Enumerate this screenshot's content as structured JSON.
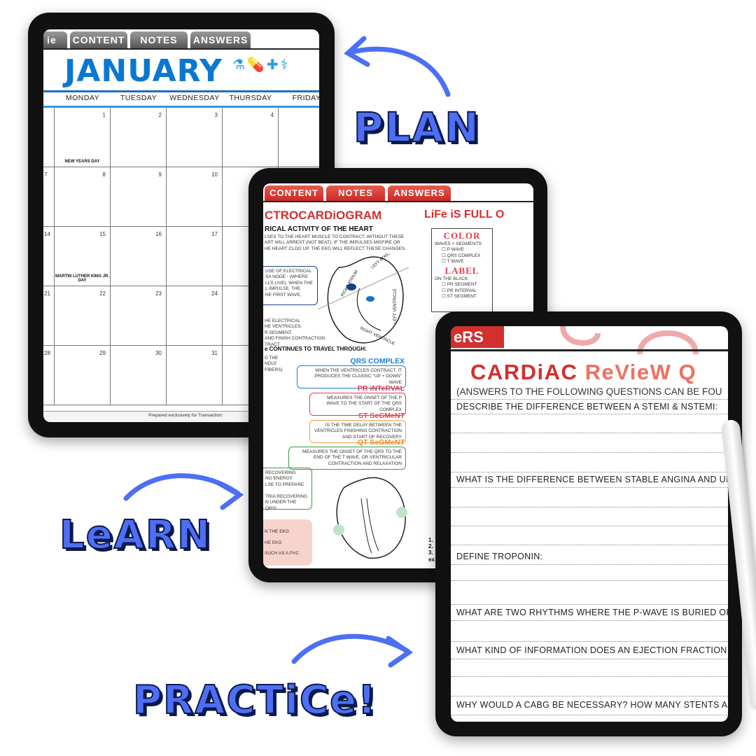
{
  "labels": {
    "plan": "PLAN",
    "learn": "LeARN",
    "practice": "PRACTiCe!"
  },
  "colors": {
    "accent_blue": "#4d6ff5",
    "calendar_blue": "#0a78d0",
    "ekg_red": "#d32f2f",
    "tab_grey": "#777777"
  },
  "calendar": {
    "tabs": [
      "ie",
      "CONTENT",
      "NOTES",
      "ANSWERS"
    ],
    "month": "JANUARY",
    "days": [
      "MONDAY",
      "TUESDAY",
      "WEDNESDAY",
      "THURSDAY",
      "FRIDAY"
    ],
    "weeks": [
      {
        "sun": "",
        "dates": [
          "1",
          "2",
          "3",
          "4",
          ""
        ],
        "holiday": "NEW YEARS DAY"
      },
      {
        "sun": "7",
        "dates": [
          "8",
          "9",
          "10",
          "",
          ""
        ],
        "holiday": ""
      },
      {
        "sun": "14",
        "dates": [
          "15",
          "16",
          "17",
          "",
          ""
        ],
        "holiday": "MARTIN LUTHER KING JR. DAY"
      },
      {
        "sun": "21",
        "dates": [
          "22",
          "23",
          "24",
          "",
          ""
        ],
        "holiday": ""
      },
      {
        "sun": "28",
        "dates": [
          "29",
          "30",
          "31",
          "",
          ""
        ],
        "holiday": ""
      }
    ],
    "footer": "Prepared exclusively for   Transaction: "
  },
  "ekg": {
    "tabs": [
      "CONTENT",
      "NOTES",
      "ANSWERS"
    ],
    "title": "CTROCARDiOGRAM",
    "subtitle": "RICAL ACTIVITY OF THE HEART",
    "intro": [
      "LSES TO THE HEART MUSCLE TO CONTRACT. WITHOUT THESE",
      "ART WILL ARREST (NOT BEAT). IF THE IMPULSES MISFIRE OR",
      "HE HEART CLOG UP, THE EKG WILL REFLECT THESE CHANGES."
    ],
    "sa_box": [
      "USE OF ELECTRICAL",
      "SA NODE - (WHERE",
      "LLS LIVE). WHEN THE",
      "L IMPULSE, THE",
      "HE FIRST WAVE,"
    ],
    "heart_labels": [
      "LEFT ATRIUM",
      "RIGHT ATRIUM",
      "LEFT VENTRICLE",
      "RIGHT VENTRICLE"
    ],
    "pr_text": [
      "HE ELECTRICAL",
      "HE VENTRICLES.",
      "R SEGMENT,",
      "AND FINISH CONTRACTION",
      "TRACT."
    ],
    "travel": "e CONTINUES TO TRAVEL THROUGH:",
    "bundle": [
      "D THE",
      "NDLE",
      "FIBERS)"
    ],
    "sections": [
      {
        "title": "QRS COMPLEX",
        "text": "WHEN THE VENTRICLES CONTRACT, IT PRODUCES THE CLASSIC \"UP + DOWN\" WAVE",
        "color": "#1a7fd0"
      },
      {
        "title": "PR iNTeRVAL",
        "text": "MEASURES THE ONSET OF THE P WAVE TO THE START OF THE QRS COMPLEX",
        "color": "#e33a4a"
      },
      {
        "title": "ST SeGMeNT",
        "text": "IS THE TIME DELAY BETWEEN THE VENTRICLES FINISHING CONTRACTION AND START OF RECOVERY",
        "color": "#ef3b4f"
      },
      {
        "title": "QT SeGMeNT",
        "text": "MEASURES THE ONSET OF THE QRS TO THE END OF THE T WAVE, OR VENTRICULAR CONTRACTION AND RELAXATION",
        "color": "#f08a20"
      }
    ],
    "recover_box": [
      "RECOVERING",
      "NG ENERGY",
      "LSE TO PREPARE",
      "",
      "TRIA RECOVERING",
      "N UNDER THE QRS!"
    ],
    "pink_box": [
      "N THE EKG",
      "HE EKG",
      "SUCH AS A PVC"
    ],
    "right_title": "LiFe iS FULL O",
    "color_head": "COLOR",
    "color_sub": "WAVES + SEGMENTS:",
    "color_items": [
      "P WAVE",
      "QRS COMPLEX",
      "T WAVE"
    ],
    "label_head": "LABEL",
    "label_sub": "ON THE BLACK",
    "label_items": [
      "PR SEGMENT",
      "PR INTERVAL",
      "ST SEGMENT"
    ],
    "list_nums": [
      "1.",
      "2.",
      "3.",
      "ex"
    ]
  },
  "quiz": {
    "tab": "eRS",
    "title_a": "CARDiAC ",
    "title_b": "ReVieW Q",
    "subtitle": "(ANSWERS TO THE FOLLOWING QUESTIONS CAN BE FOU",
    "questions": [
      "DESCRIBE THE DIFFERENCE BETWEEN A STEMI & NSTEMI:",
      "WHAT IS THE DIFFERENCE BETWEEN STABLE ANGINA AND UI",
      "DEFINE TROPONIN:",
      "WHAT ARE TWO RHYTHMS WHERE THE P-WAVE IS BURIED OR",
      "WHAT KIND OF INFORMATION DOES AN EJECTION FRACTION",
      "WHY WOULD A CABG BE NECESSARY? HOW MANY STENTS ARE"
    ]
  }
}
